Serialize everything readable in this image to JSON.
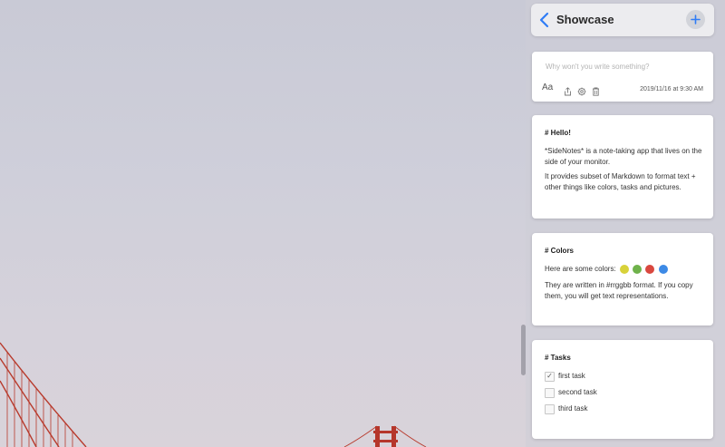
{
  "header": {
    "title": "Showcase",
    "back_icon": "chevron-left-icon",
    "add_icon": "plus-icon",
    "accent": "#2f7cf6"
  },
  "composer": {
    "placeholder": "Why won't you write something?",
    "value": "",
    "font_label": "Aa",
    "timestamp": "2019/11/16 at 9:30 AM",
    "tools": [
      "font-icon",
      "share-icon",
      "settings-icon",
      "trash-icon"
    ]
  },
  "notes": [
    {
      "title": "# Hello!",
      "paragraphs": [
        "*SideNotes* is a note-taking app that lives on the side of your monitor.",
        "It provides subset of Markdown to format text + other things like colors, tasks and pictures."
      ]
    },
    {
      "title": "# Colors",
      "intro": "Here are some colors:",
      "colors": [
        "#d8d23a",
        "#6fb24b",
        "#d9483f",
        "#3d8ae6"
      ],
      "paragraph": "They are written in #rrggbb format. If you copy them, you will get text representations."
    },
    {
      "title": "# Tasks",
      "tasks": [
        {
          "label": "first task",
          "done": true
        },
        {
          "label": "second task",
          "done": false
        },
        {
          "label": "third task",
          "done": false
        }
      ]
    }
  ]
}
